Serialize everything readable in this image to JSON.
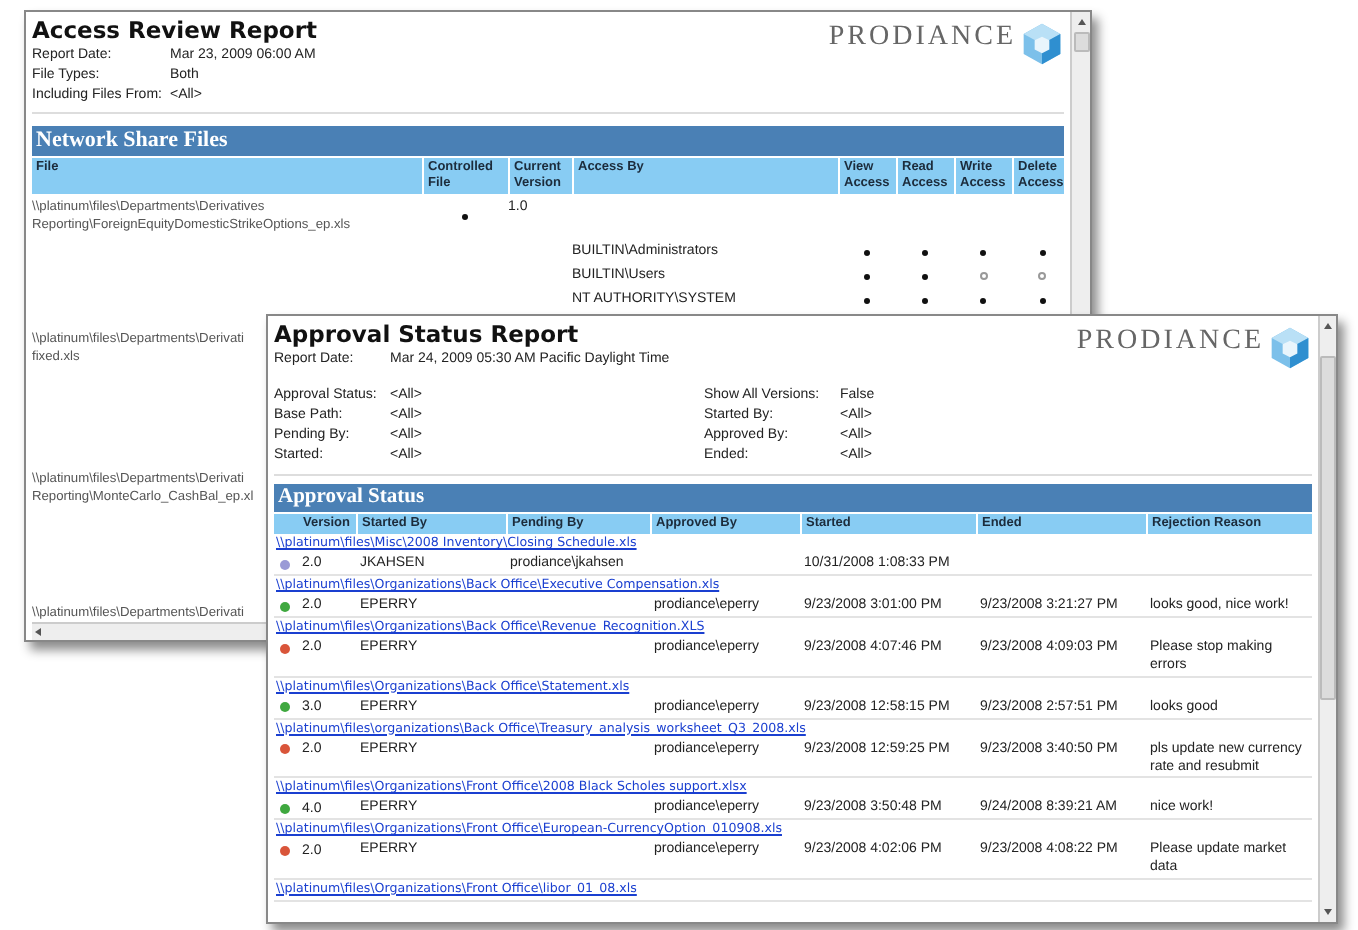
{
  "back_window": {
    "title": "Access Review Report",
    "logo": "PRODIANCE",
    "meta": [
      {
        "label": "Report Date:",
        "value": "Mar 23, 2009 06:00 AM"
      },
      {
        "label": "File Types:",
        "value": "Both"
      },
      {
        "label": "Including Files From:",
        "value": "<All>"
      }
    ],
    "section": "Network Share Files",
    "columns": [
      "File",
      "Controlled File",
      "Current Version",
      "Access By",
      "View Access",
      "Read Access",
      "Write Access",
      "Delete Access"
    ],
    "files": [
      {
        "lines": [
          "\\\\platinum\\files\\Departments\\Derivatives",
          "Reporting\\ForeignEquityDomesticStrikeOptions_ep.xls"
        ],
        "controlled": true,
        "version": "1.0",
        "access": [
          {
            "name": "BUILTIN\\Administrators",
            "view": true,
            "read": true,
            "write": true,
            "delete": true
          },
          {
            "name": "BUILTIN\\Users",
            "view": true,
            "read": true,
            "write": false,
            "delete": false
          },
          {
            "name": "NT AUTHORITY\\SYSTEM",
            "view": true,
            "read": true,
            "write": true,
            "delete": true
          }
        ]
      },
      {
        "lines": [
          "\\\\platinum\\files\\Departments\\Derivati",
          "fixed.xls"
        ]
      },
      {
        "lines": [
          "\\\\platinum\\files\\Departments\\Derivati",
          "Reporting\\MonteCarlo_CashBal_ep.xl"
        ]
      },
      {
        "lines": [
          "\\\\platinum\\files\\Departments\\Derivati"
        ]
      }
    ]
  },
  "front_window": {
    "title": "Approval Status Report",
    "logo": "PRODIANCE",
    "report_date": {
      "label": "Report Date:",
      "value": "Mar 24, 2009 05:30 AM Pacific Daylight Time"
    },
    "filters": [
      {
        "label": "Approval Status:",
        "value": "<All>"
      },
      {
        "label": "Show All Versions:",
        "value": "False"
      },
      {
        "label": "Base Path:",
        "value": "<All>"
      },
      {
        "label": "Started By:",
        "value": "<All>"
      },
      {
        "label": "Pending By:",
        "value": "<All>"
      },
      {
        "label": "Approved By:",
        "value": "<All>"
      },
      {
        "label": "Started:",
        "value": "<All>"
      },
      {
        "label": "Ended:",
        "value": "<All>"
      }
    ],
    "section": "Approval Status",
    "columns": [
      "Version",
      "Started By",
      "Pending By",
      "Approved By",
      "Started",
      "Ended",
      "Rejection Reason"
    ],
    "files": [
      {
        "path": "\\\\platinum\\files\\Misc\\2008 Inventory\\Closing Schedule.xls",
        "color": "#9a9ad6",
        "version": "2.0",
        "started_by": "JKAHSEN",
        "pending_by": "prodiance\\jkahsen",
        "started": "10/31/2008 1:08:33 PM"
      },
      {
        "path": "\\\\platinum\\files\\Organizations\\Back Office\\Executive Compensation.xls",
        "color": "#3fa83f",
        "version": "2.0",
        "started_by": "EPERRY",
        "approved_by": "prodiance\\eperry",
        "started": "9/23/2008 3:01:00 PM",
        "ended": "9/23/2008 3:21:27 PM",
        "reason": "looks good, nice work!"
      },
      {
        "path": "\\\\platinum\\files\\Organizations\\Back Office\\Revenue_Recognition.XLS",
        "color": "#d9553a",
        "version": "2.0",
        "started_by": "EPERRY",
        "approved_by": "prodiance\\eperry",
        "started": "9/23/2008 4:07:46 PM",
        "ended": "9/23/2008 4:09:03 PM",
        "reason": "Please stop making errors"
      },
      {
        "path": "\\\\platinum\\files\\Organizations\\Back Office\\Statement.xls",
        "color": "#3fa83f",
        "version": "3.0",
        "started_by": "EPERRY",
        "approved_by": "prodiance\\eperry",
        "started": "9/23/2008 12:58:15 PM",
        "ended": "9/23/2008 2:57:51 PM",
        "reason": "looks good"
      },
      {
        "path": "\\\\platinum\\files\\organizations\\Back Office\\Treasury_analysis_worksheet_Q3_2008.xls",
        "color": "#d9553a",
        "version": "2.0",
        "started_by": "EPERRY",
        "approved_by": "prodiance\\eperry",
        "started": "9/23/2008 12:59:25 PM",
        "ended": "9/23/2008 3:40:50 PM",
        "reason": "pls update new currency rate and resubmit"
      },
      {
        "path": "\\\\platinum\\files\\Organizations\\Front Office\\2008 Black Scholes support.xlsx",
        "color": "#3fa83f",
        "version": "4.0",
        "started_by": "EPERRY",
        "approved_by": "prodiance\\eperry",
        "started": "9/23/2008 3:50:48 PM",
        "ended": "9/24/2008 8:39:21 AM",
        "reason": "nice work!"
      },
      {
        "path": "\\\\platinum\\files\\Organizations\\Front Office\\European-CurrencyOption_010908.xls",
        "color": "#d9553a",
        "version": "2.0",
        "started_by": "EPERRY",
        "approved_by": "prodiance\\eperry",
        "started": "9/23/2008 4:02:06 PM",
        "ended": "9/23/2008 4:08:22 PM",
        "reason": "Please update market data"
      },
      {
        "path": "\\\\platinum\\files\\Organizations\\Front Office\\libor_01_08.xls"
      }
    ]
  }
}
